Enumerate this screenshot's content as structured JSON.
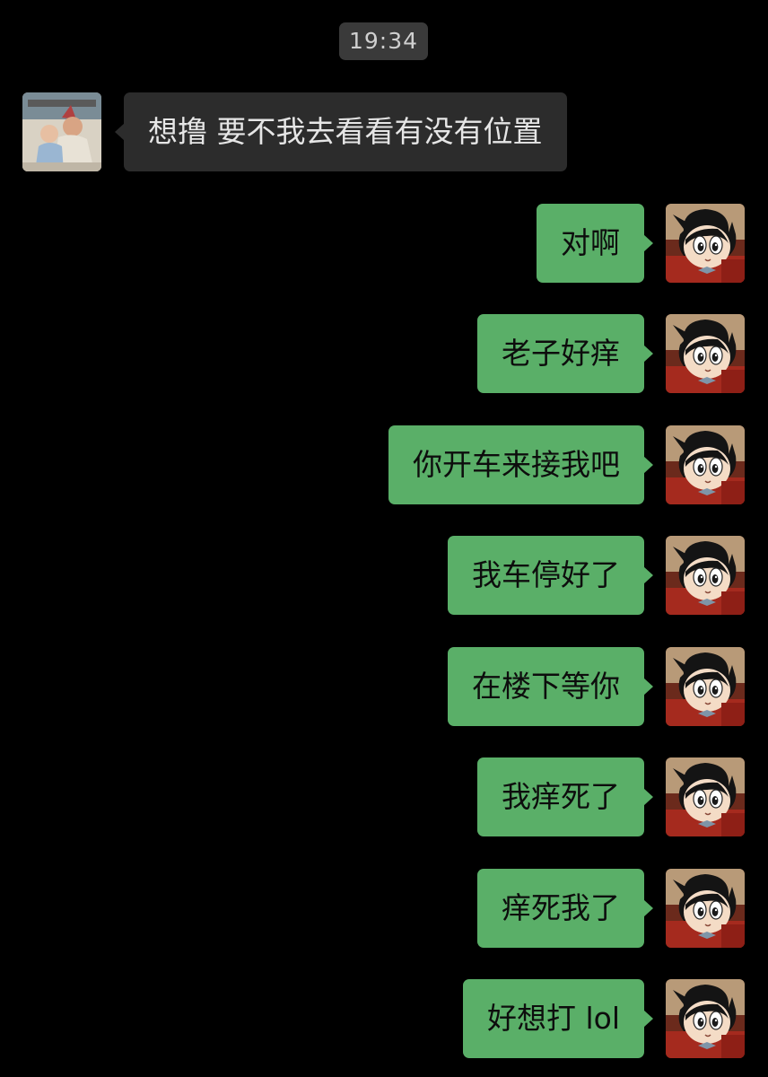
{
  "timestamp": "19:34",
  "messages": [
    {
      "sender": "other",
      "text": "想撸 要不我去看看有没有位置"
    },
    {
      "sender": "self",
      "text": "对啊"
    },
    {
      "sender": "self",
      "text": "老子好痒"
    },
    {
      "sender": "self",
      "text": "你开车来接我吧"
    },
    {
      "sender": "self",
      "text": "我车停好了"
    },
    {
      "sender": "self",
      "text": "在楼下等你"
    },
    {
      "sender": "self",
      "text": "我痒死了"
    },
    {
      "sender": "self",
      "text": "痒死我了"
    },
    {
      "sender": "self",
      "text": "好想打 lol"
    }
  ],
  "colors": {
    "background": "#000000",
    "incoming_bubble": "#2c2c2c",
    "outgoing_bubble": "#5aaf68",
    "timestamp_bg": "#3a3a3a"
  }
}
